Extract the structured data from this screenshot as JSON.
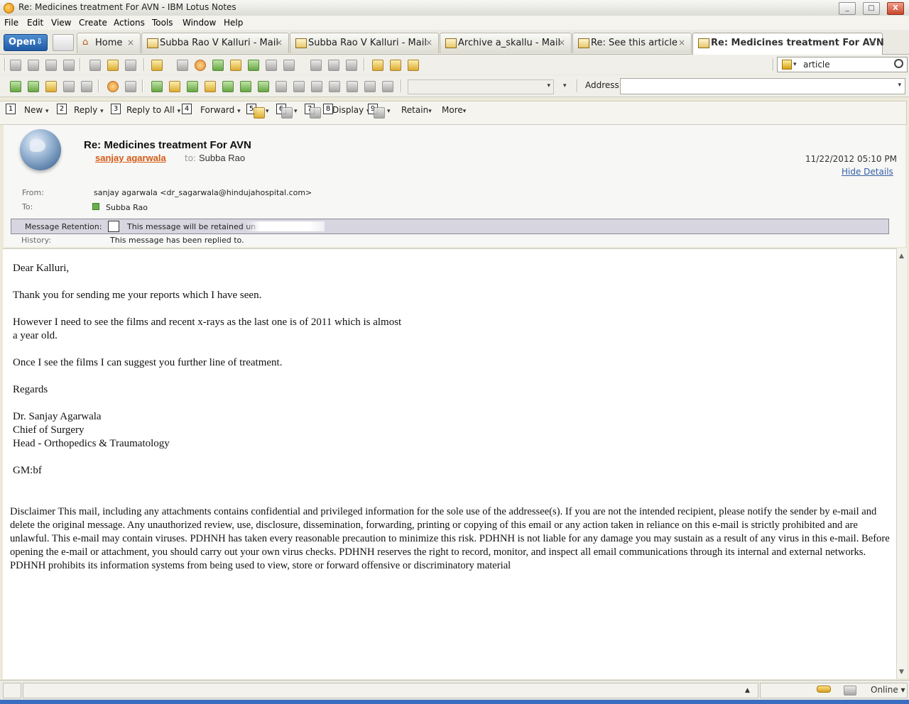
{
  "window": {
    "title": "Re: Medicines treatment  For AVN - IBM Lotus Notes",
    "minimize_label": "_",
    "maximize_label": "□",
    "close_label": "X"
  },
  "menu": [
    "File",
    "Edit",
    "View",
    "Create",
    "Actions",
    "Tools",
    "Window",
    "Help"
  ],
  "tabs": {
    "open_label": "Open",
    "items": [
      {
        "label": "Home",
        "icon": "home-icon"
      },
      {
        "label": "Subba Rao V Kalluri - Mail",
        "icon": "mail-icon"
      },
      {
        "label": "Subba Rao V Kalluri - Mail",
        "icon": "mail-icon"
      },
      {
        "label": "Archive a_skallu - Mail",
        "icon": "mail-icon"
      },
      {
        "label": "Re: See this article",
        "icon": "document-icon"
      },
      {
        "label": "Re: Medicines treatment  For AVN",
        "icon": "document-icon"
      }
    ],
    "close_glyph": "×"
  },
  "search": {
    "value": "article"
  },
  "address": {
    "label": "Address",
    "value": ""
  },
  "actions": {
    "keytips": [
      "1",
      "2",
      "3",
      "4",
      "5",
      "6",
      "7",
      "8",
      "9"
    ],
    "new": "New",
    "reply": "Reply",
    "reply_all": "Reply to All",
    "forward": "Forward",
    "display": "Display",
    "retain": "Retain",
    "more": "More"
  },
  "message": {
    "subject": "Re: Medicines treatment  For AVN",
    "sender": "sanjay agarwala",
    "to_label": "to:",
    "to_name": "Subba Rao",
    "datetime": "11/22/2012 05:10 PM",
    "hide_details": "Hide Details",
    "from_label": "From:",
    "from_value": "sanjay agarwala <dr_sagarwala@hindujahospital.com>",
    "to_field_label": "To:",
    "to_field_value": "Subba Rao",
    "retention_label": "Message Retention:",
    "retention_value": "This message will be retained un",
    "history_label": "History:",
    "history_value": "This message has been replied to."
  },
  "body": {
    "greeting": "Dear Kalluri,",
    "p1": "Thank you for sending me your reports which I have seen.",
    "p2a": "However I need to see the films and recent x-rays as the last one is of 2011 which is almost",
    "p2b": "a year old.",
    "p3": "Once I see the films I can suggest you further line of treatment.",
    "regards": "Regards",
    "sig1": "Dr. Sanjay Agarwala",
    "sig2": "Chief of Surgery",
    "sig3": "Head - Orthopedics & Traumatology",
    "initials": "GM:bf",
    "disclaimer": "Disclaimer This mail, including any attachments contains confidential and privileged information for the sole use of the addressee(s). If you are not the intended recipient, please notify the sender by e-mail and delete the original message. Any unauthorized review, use, disclosure, dissemination, forwarding, printing or copying of this email or any action taken in reliance on this e-mail is strictly prohibited and are unlawful. This e-mail may contain viruses. PDHNH has taken every reasonable precaution to minimize this risk. PDHNH is not liable for any damage you may sustain as a result of any virus in this e-mail. Before opening the e-mail or attachment, you should carry out your own virus checks. PDHNH reserves the right to record, monitor, and inspect all email communications through its internal and external networks. PDHNH prohibits its information systems from being used to view, store or forward offensive or discriminatory material"
  },
  "status": {
    "online": "Online ▾"
  }
}
